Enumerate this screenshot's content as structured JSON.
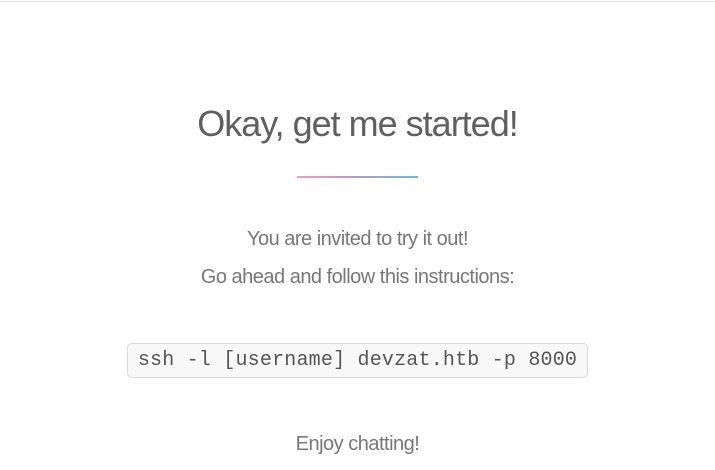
{
  "section": {
    "heading": "Okay, get me started!",
    "intro_lines": [
      "You are invited to try it out!",
      "Go ahead and follow this instructions:"
    ],
    "command": "ssh -l [username] devzat.htb -p 8000",
    "closing": "Enjoy chatting!"
  },
  "colors": {
    "divider_start": "#e8a3b4",
    "divider_end": "#6fb8dc",
    "text": "#777777",
    "code_background": "#f8f8f8"
  }
}
